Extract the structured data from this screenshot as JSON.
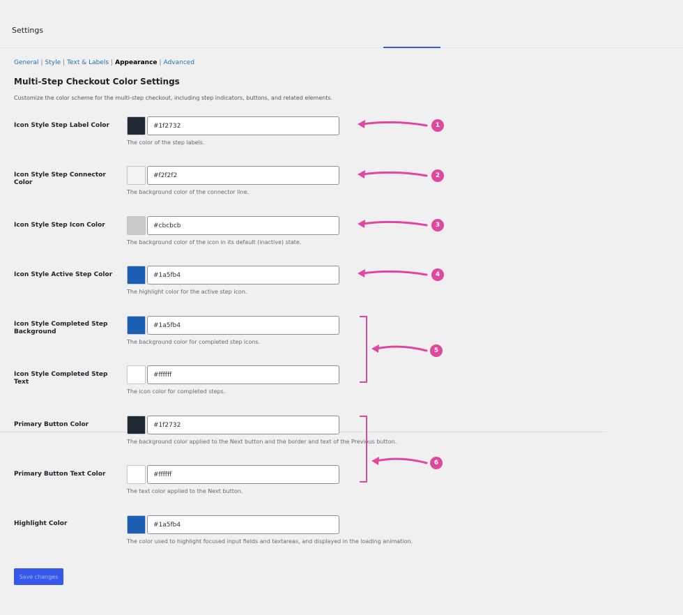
{
  "header": {
    "title": "Settings"
  },
  "nav": {
    "tabs": [
      {
        "label": "General"
      },
      {
        "label": "Style"
      },
      {
        "label": "Text & Labels"
      },
      {
        "label": "Appearance"
      },
      {
        "label": "Advanced"
      }
    ],
    "separator": "|"
  },
  "section": {
    "title": "Multi-Step Checkout Color Settings",
    "description": "Customize the color scheme for the multi-step checkout, including step indicators, buttons, and related elements."
  },
  "fields": [
    {
      "label": "Icon Style Step Label Color",
      "value": "#1f2732",
      "color": "#1f2732",
      "description": "The color of the step labels."
    },
    {
      "label": "Icon Style Step Connector Color",
      "value": "#f2f2f2",
      "color": "#f2f2f2",
      "description": "The background color of the connector line."
    },
    {
      "label": "Icon Style Step Icon Color",
      "value": "#cbcbcb",
      "color": "#cbcbcb",
      "description": "The background color of the icon in its default (inactive) state."
    },
    {
      "label": "Icon Style Active Step Color",
      "value": "#1a5fb4",
      "color": "#1a5fb4",
      "description": "The highlight color for the active step icon."
    },
    {
      "label": "Icon Style Completed Step Background",
      "value": "#1a5fb4",
      "color": "#1a5fb4",
      "description": "The background color for completed step icons."
    },
    {
      "label": "Icon Style Completed Step Text",
      "value": "#ffffff",
      "color": "#ffffff",
      "description": "The icon color for completed steps."
    },
    {
      "label": "Primary Button Color",
      "value": "#1f2732",
      "color": "#1f2732",
      "description": "The background color applied to the Next button and the border and text of the Previous button."
    },
    {
      "label": "Primary Button Text Color",
      "value": "#ffffff",
      "color": "#ffffff",
      "description": "The text color applied to the Next button."
    },
    {
      "label": "Highlight Color",
      "value": "#1a5fb4",
      "color": "#1a5fb4",
      "description": "The color used to highlight focused input fields and textareas, and displayed in the loading animation."
    }
  ],
  "save_button": {
    "label": "Save changes"
  },
  "annotations": {
    "badges": [
      "1",
      "2",
      "3",
      "4",
      "5",
      "6"
    ],
    "color": "#e0479e"
  }
}
